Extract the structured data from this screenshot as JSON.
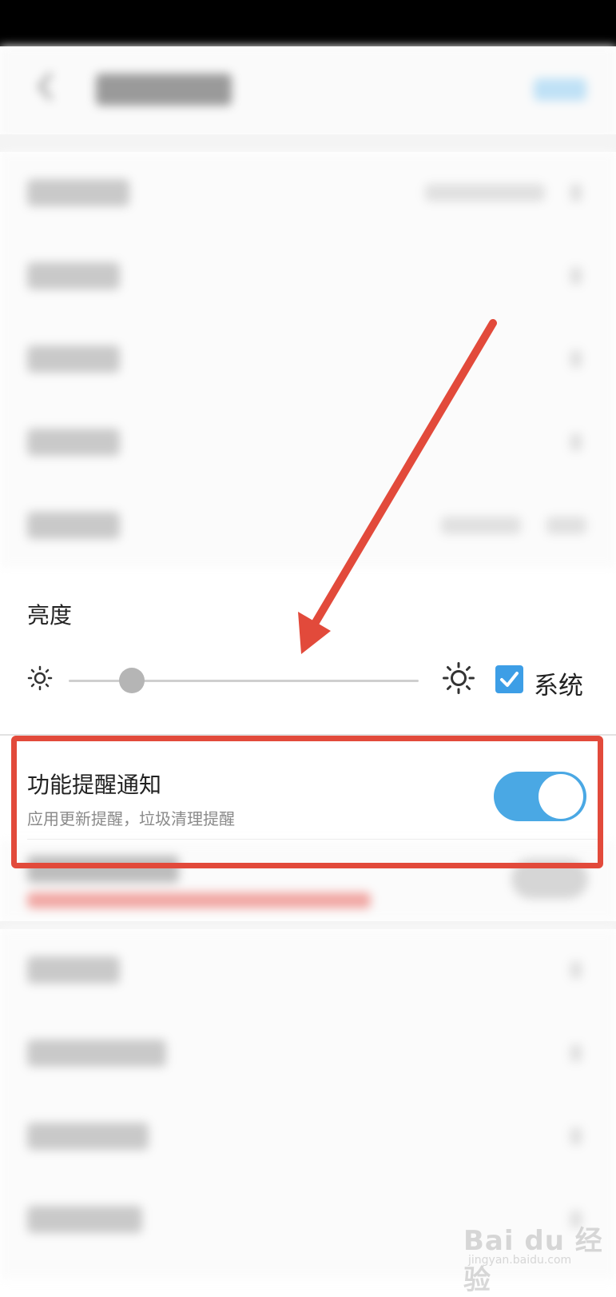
{
  "brightness": {
    "title": "亮度",
    "slider_level_percent": 18,
    "system_checkbox": {
      "label": "系统",
      "checked": true
    }
  },
  "notification": {
    "title": "功能提醒通知",
    "subtitle": "应用更新提醒，垃圾清理提醒",
    "toggle_on": true
  },
  "watermark": {
    "brand": "Bai du 经验",
    "site": "jingyan.baidu.com"
  },
  "colors": {
    "accent": "#4aa8e4",
    "annotation_red": "#e24a3b"
  }
}
